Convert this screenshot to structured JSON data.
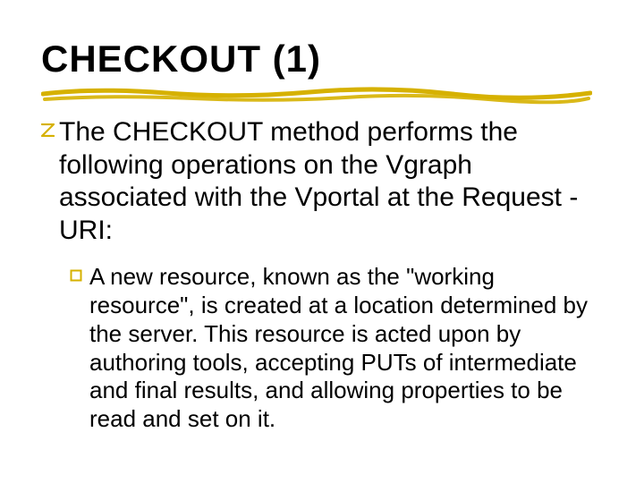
{
  "title": "CHECKOUT (1)",
  "bullets": {
    "level1": {
      "text": "The CHECKOUT method performs the following operations on the Vgraph associated with the Vportal at the Request -URI:"
    },
    "level2": {
      "text": "A new resource, known as the \"working resource\", is created at a location determined by the server. This resource is acted upon by authoring tools, accepting PUTs of intermediate and final results, and allowing properties to be read and set on it."
    }
  },
  "colors": {
    "accent": "#d6b100"
  }
}
